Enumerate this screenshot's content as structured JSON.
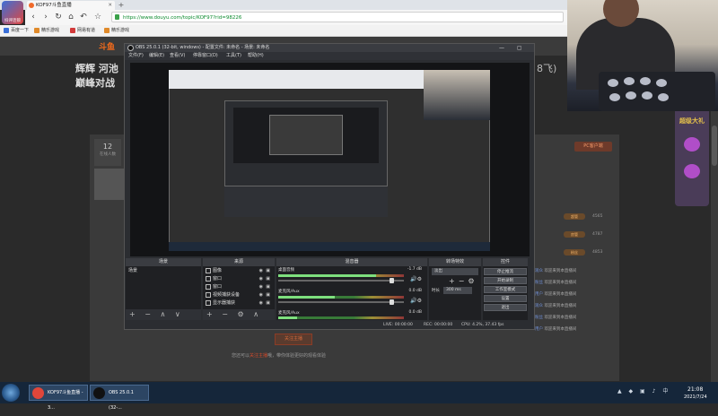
{
  "browser": {
    "logo_label": "抖评连锁",
    "tab_title": "KOF97斗鱼直播",
    "new_tab": "+",
    "url": "https://www.douyu.com/topic/KOF97?rid=98226",
    "bookmarks": [
      "百度一下",
      "精乐游戏",
      "网易有道",
      "精乐游戏"
    ]
  },
  "page": {
    "logo": "斗鱼",
    "title_line1": "辉辉 河池",
    "title_line2": "巅峰对战",
    "title_right": "8飞)",
    "viewer_count": "12",
    "viewer_label": "在线人数",
    "follow_button": "关注主播",
    "footer_prefix": "您还可以",
    "footer_highlight": "关注主播",
    "footer_suffix": "哦，带你体验更好的观看体验",
    "pc_client_button": "PC客户端",
    "gift_badge_text": "超级大礼",
    "chat_lines": [
      {
        "user": "观众",
        "text": "欢迎来到本直播间"
      },
      {
        "user": "粉丝",
        "text": "欢迎来到本直播间"
      },
      {
        "user": "用户",
        "text": "欢迎来到本直播间"
      },
      {
        "user": "观众",
        "text": "欢迎来到本直播间"
      },
      {
        "user": "粉丝",
        "text": "欢迎来到本直播间"
      },
      {
        "user": "用户",
        "text": "欢迎来到本直播间"
      }
    ],
    "rank_numbers": [
      "4565",
      "4787",
      "4853"
    ],
    "rank_pills": [
      "超管",
      "房管",
      "粉丝"
    ]
  },
  "obs": {
    "title": "OBS 25.0.1 (32-bit, windows) - 配置文件: 未命名 - 场景: 未命名",
    "window_controls": "— ▢ ✕",
    "menus": [
      "文件(F)",
      "编辑(E)",
      "查看(V)",
      "停靠窗口(D)",
      "工具(T)",
      "帮助(H)"
    ],
    "docks": {
      "scenes": "场景",
      "sources": "来源",
      "mixer": "混音器",
      "transitions": "转场特效",
      "controls": "控件"
    },
    "scene_items": [
      "场景"
    ],
    "source_items": [
      "图像",
      "窗口",
      "窗口",
      "视频捕获设备",
      "显示器捕获"
    ],
    "mixer": [
      {
        "name": "桌面音频",
        "db": "-1.7 dB",
        "level": 0.78,
        "volume": 0.92
      },
      {
        "name": "麦克风/Aux",
        "db": "0.0 dB",
        "level": 0.45,
        "volume": 0.92
      },
      {
        "name": "麦克风/Aux",
        "db": "0.0 dB",
        "level": 0.15,
        "volume": 0.92
      }
    ],
    "transition": {
      "type": "淡出",
      "duration_label": "时长",
      "duration": "300 ms"
    },
    "controls": [
      "停止推流",
      "开始录制",
      "工作室模式",
      "设置",
      "退出"
    ],
    "dock_footer_icons": "+ − ∧ ∨",
    "source_footer_icons": "+ − ⚙ ∧ ∨",
    "status": {
      "live": "LIVE: 00:00:00",
      "rec": "REC: 00:00:00",
      "cpu": "CPU: 4.2%, 37.43 fps"
    }
  },
  "taskbar": {
    "items": [
      {
        "label": "KOF97斗鱼直播 - 3...",
        "color": "#e0463a"
      },
      {
        "label": "OBS 25.0.1 (32-...",
        "color": "#111111"
      }
    ],
    "tray": "▲ ◆ ▣ ♪ 中",
    "time": "21:08",
    "date": "2021/7/24"
  }
}
